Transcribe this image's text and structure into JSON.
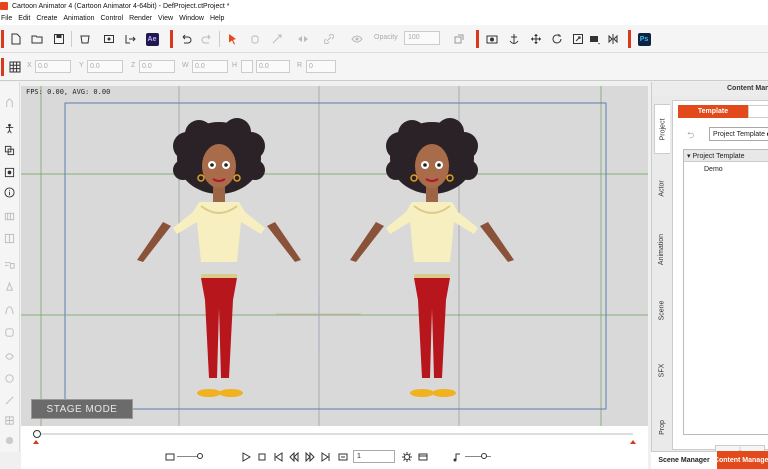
{
  "window": {
    "title": "Cartoon Animator 4  (Cartoon Animator 4-64bit) - DefProject.ctProject *"
  },
  "menu": [
    "File",
    "Edit",
    "Create",
    "Animation",
    "Control",
    "Render",
    "View",
    "Window",
    "Help"
  ],
  "toolbar": {
    "ae_label": "Ae",
    "opacity_label": "Opacity",
    "opacity_value": "100",
    "ps_label": "Ps"
  },
  "transform": {
    "x_label": "X",
    "x_value": "0.0",
    "y_label": "Y",
    "y_value": "0.0",
    "z_label": "Z",
    "z_value": "0.0",
    "w_label": "W",
    "w_value": "0.0",
    "h_label": "H",
    "h_value": "0.0",
    "r_label": "R",
    "r_value": "0"
  },
  "viewport": {
    "fps_text": "FPS: 0.00, AVG: 0.00",
    "stage_mode_label": "STAGE MODE",
    "background": "#d9d9d9"
  },
  "playback": {
    "frame_value": "1"
  },
  "right_panel": {
    "title": "Content Manager",
    "vertical_tabs": [
      "Project",
      "Actor",
      "Animation",
      "Scene",
      "SFX",
      "Prop"
    ],
    "template_tab": "Template",
    "dropdown_value": "Project Template",
    "tree_header": "Project Template",
    "tree_items": [
      "Demo"
    ]
  },
  "bottom_tabs": {
    "scene_manager": "Scene Manager",
    "content_manager": "Content Manager"
  },
  "colors": {
    "accent": "#e24a1c",
    "toolbar_red": "#d8381c"
  }
}
